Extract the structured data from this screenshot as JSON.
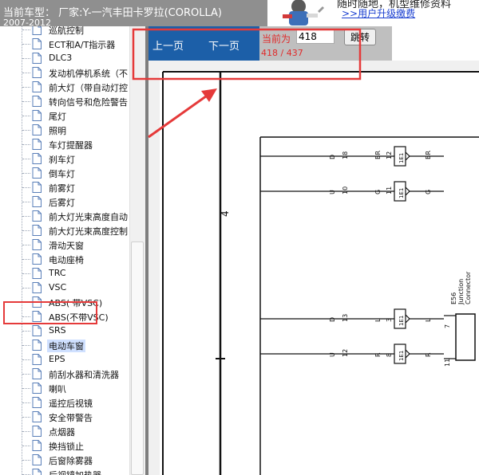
{
  "header": {
    "car_title": "当前车型： 厂家:Y-一汽丰田卡罗拉(COROLLA)",
    "car_years": "2007-2012",
    "ad_text": "随时随地，机型维修资料",
    "ad_link": ">>用户升级缴费"
  },
  "tree": {
    "items": [
      {
        "label": "巡航控制"
      },
      {
        "label": "ECT和A/T指示器"
      },
      {
        "label": "DLC3"
      },
      {
        "label": "发动机停机系统（不"
      },
      {
        "label": "前大灯（带自动灯控"
      },
      {
        "label": "转向信号和危险警告"
      },
      {
        "label": "尾灯"
      },
      {
        "label": "照明"
      },
      {
        "label": "车灯提醒器"
      },
      {
        "label": "刹车灯"
      },
      {
        "label": "倒车灯"
      },
      {
        "label": "前雾灯"
      },
      {
        "label": "后雾灯"
      },
      {
        "label": "前大灯光束高度自动"
      },
      {
        "label": "前大灯光束高度控制"
      },
      {
        "label": "滑动天窗"
      },
      {
        "label": "电动座椅"
      },
      {
        "label": "TRC"
      },
      {
        "label": "VSC"
      },
      {
        "label": "ABS( 带VSC)"
      },
      {
        "label": "ABS(不带VSC)"
      },
      {
        "label": "SRS"
      },
      {
        "label": "电动车窗",
        "selected": true
      },
      {
        "label": "EPS"
      },
      {
        "label": "前刮水器和清洗器"
      },
      {
        "label": "喇叭"
      },
      {
        "label": "遥控后视镜"
      },
      {
        "label": "安全带警告"
      },
      {
        "label": "点烟器"
      },
      {
        "label": "换挡锁止"
      },
      {
        "label": "后窗除雾器"
      },
      {
        "label": "后视镜加热器"
      }
    ]
  },
  "toolbar": {
    "prev_label": "上一页",
    "next_label": "下一页",
    "current_label": "当前为",
    "page_value": "418",
    "jump_label": "跳转",
    "page_count": "418 / 437"
  },
  "diagram": {
    "section_number": "4",
    "connector_name": "E56",
    "connector_desc_1": "Junction",
    "connector_desc_2": "Connector",
    "rows": [
      {
        "letter": "D",
        "num": "18",
        "conn_label": "1E1",
        "conn_pin": "12",
        "wire": "BR",
        "wire2": "BR"
      },
      {
        "letter": "U",
        "num": "10",
        "conn_label": "1E1",
        "conn_pin": "11",
        "wire": "G",
        "wire2": "G"
      },
      {
        "letter": "D",
        "num": "13",
        "conn_label": "1E1",
        "conn_pin": "3",
        "wire": "L",
        "wire2": "L"
      },
      {
        "letter": "U",
        "num": "12",
        "conn_label": "1E1",
        "conn_pin": "8",
        "wire": "R",
        "wire2": "R"
      }
    ],
    "right_pins": [
      "7",
      "11"
    ]
  },
  "colors": {
    "toolbar_bg": "#1c5fa8",
    "annotation_red": "#e53a3a",
    "page_text_red": "#e02a2a"
  }
}
